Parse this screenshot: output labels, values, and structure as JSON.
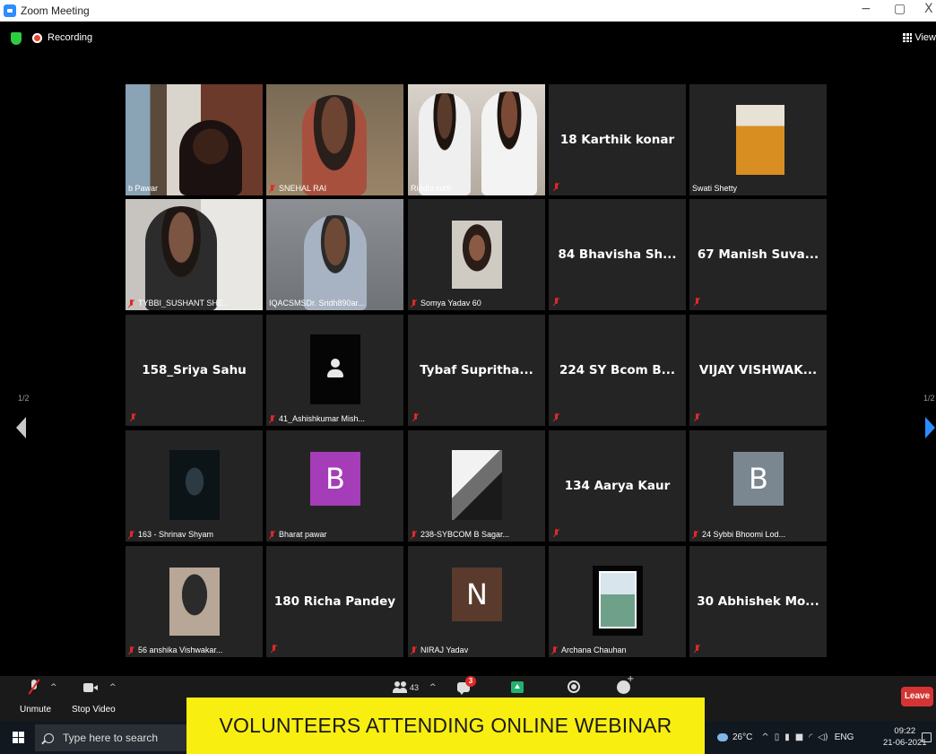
{
  "window": {
    "title": "Zoom Meeting",
    "minimize": "−",
    "restore": "▢",
    "close": "X"
  },
  "topbar": {
    "recording_label": "Recording",
    "view_label": "View"
  },
  "gallery": {
    "page_left": "1/2",
    "page_right": "1/2",
    "tiles": [
      {
        "label": "b Pawar"
      },
      {
        "label": "SNEHAL RAI"
      },
      {
        "label": "Riddhi surti"
      },
      {
        "center_name": "18 Karthik konar"
      },
      {
        "label": "Swati Shetty"
      },
      {
        "label": "TYBBI_SUSHANT SHE..."
      },
      {
        "label": "IQACSMSDr. Sridh890ar..."
      },
      {
        "label": "Somya Yadav 60"
      },
      {
        "center_name": "84  Bhavisha Sh..."
      },
      {
        "center_name": "67  Manish Suva..."
      },
      {
        "center_name": "158_Sriya Sahu"
      },
      {
        "label": "41_Ashishkumar Mish..."
      },
      {
        "center_name": "Tybaf  Supritha..."
      },
      {
        "center_name": "224 SY Bcom B..."
      },
      {
        "center_name": "VIJAY  VISHWAK..."
      },
      {
        "label": "163 - Shrinav Shyam"
      },
      {
        "label": "Bharat pawar",
        "avatar": "B",
        "avatar_color": "#a63db8"
      },
      {
        "label": "238-SYBCOM B Sagar..."
      },
      {
        "center_name": "134 Aarya Kaur"
      },
      {
        "label": "24 Sybbi Bhoomi Lod...",
        "avatar": "B",
        "avatar_color": "#7a8790"
      },
      {
        "label": "56 anshika Vishwakar..."
      },
      {
        "center_name": "180 Richa Pandey"
      },
      {
        "label": "NIRAJ Yadav",
        "avatar": "N",
        "avatar_color": "#5a3a2c"
      },
      {
        "label": "Archana Chauhan"
      },
      {
        "center_name": "30  Abhishek Mo..."
      }
    ]
  },
  "toolbar": {
    "unmute_label": "Unmute",
    "stop_video_label": "Stop Video",
    "participants_count": "43",
    "chat_badge": "3",
    "leave_label": "Leave",
    "caret": "^"
  },
  "caption": {
    "text": "VOLUNTEERS ATTENDING ONLINE WEBINAR"
  },
  "taskbar": {
    "search_placeholder": "Type here to search",
    "temperature": "26°C",
    "tray_caret": "^",
    "language": "ENG",
    "time": "09:22",
    "date": "21-06-2021"
  },
  "colors": {
    "active_speaker_border": "#c7e34a",
    "leave_red": "#d53434",
    "caption_yellow": "#f8ee10",
    "next_arrow_blue": "#2d8cff"
  }
}
